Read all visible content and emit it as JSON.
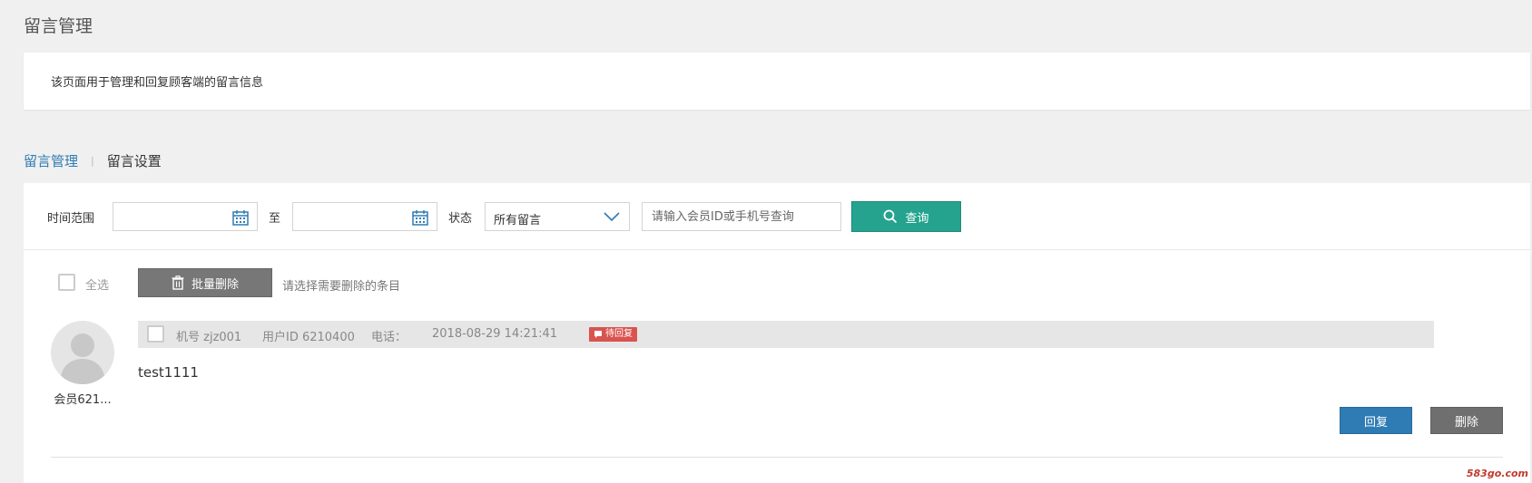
{
  "page": {
    "title": "留言管理"
  },
  "description": {
    "text": "该页面用于管理和回复顾客端的留言信息"
  },
  "tabs": [
    {
      "label": "留言管理",
      "active": true
    },
    {
      "label": "留言设置",
      "active": false
    }
  ],
  "tab_separator": "|",
  "filter": {
    "time_range_label": "时间范围",
    "to_label": "至",
    "start_date": "",
    "end_date": "",
    "status_label": "状态",
    "status_value": "所有留言",
    "search_placeholder": "请输入会员ID或手机号查询",
    "query_button": "查询"
  },
  "toolbar": {
    "select_all_label": "全选",
    "batch_delete_button": "批量删除",
    "hint": "请选择需要删除的条目"
  },
  "messages": [
    {
      "avatar_name": "会员621...",
      "machine_no": "机号 zjz001",
      "user_id": "用户ID 6210400",
      "phone": "电话：",
      "datetime": "2018-08-29 14:21:41",
      "status_badge": "待回复",
      "content": "test1111",
      "reply_button": "回复",
      "delete_button": "删除"
    }
  ],
  "watermark": "583go.com",
  "colors": {
    "accent_blue": "#2f7bb3",
    "query_green": "#25a38e",
    "badge_red": "#d9534f",
    "delete_gray": "#6f6f6f"
  }
}
